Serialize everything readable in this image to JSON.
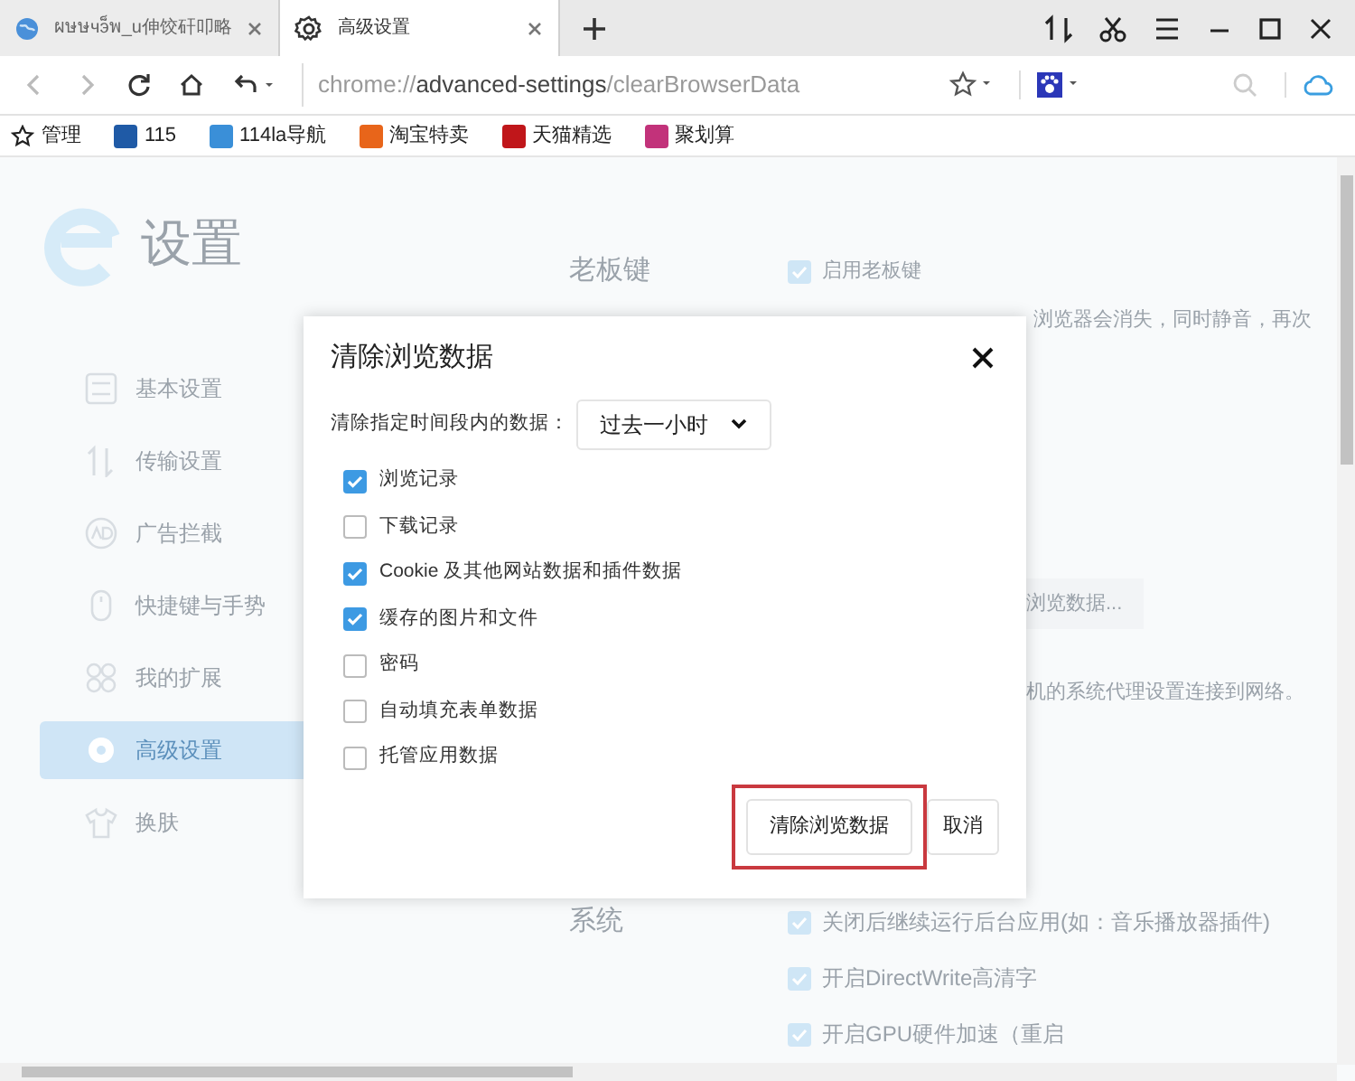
{
  "tabs": [
    {
      "title": "ผษษчэ็พ_u伸饺矸叩略",
      "selected": false
    },
    {
      "title": "高级设置",
      "selected": true
    }
  ],
  "address_bar": {
    "url_scheme": "chrome://",
    "url_host": "advanced-settings",
    "url_path": "/clearBrowserData"
  },
  "bookmarks": [
    {
      "label": "管理"
    },
    {
      "label": "115",
      "color": "#1f5aa6"
    },
    {
      "label": "114la导航",
      "color": "#3a8fd8"
    },
    {
      "label": "淘宝特卖",
      "color": "#e8651a"
    },
    {
      "label": "天猫精选",
      "color": "#c0161a"
    },
    {
      "label": "聚划算",
      "color": "#c2327a"
    }
  ],
  "sidebar": {
    "title": "设置",
    "items": [
      {
        "label": "基本设置",
        "selected": false
      },
      {
        "label": "传输设置",
        "selected": false
      },
      {
        "label": "广告拦截",
        "selected": false
      },
      {
        "label": "快捷键与手势",
        "selected": false
      },
      {
        "label": "我的扩展",
        "selected": false
      },
      {
        "label": "高级设置",
        "selected": true
      },
      {
        "label": "换肤",
        "selected": false
      }
    ]
  },
  "background": {
    "boss_key": {
      "heading": "老板键",
      "option": "启用老板键",
      "checked": true,
      "hint": "浏览器会消失，同时静音，再次"
    },
    "clear_button": "浏览数据...",
    "proxy_text": "机的系统代理设置连接到网络。",
    "system": {
      "heading": "系统",
      "options": [
        {
          "label": "关闭后继续运行后台应用(如：音乐播放器插件)",
          "checked": true
        },
        {
          "label": "开启DirectWrite高清字",
          "checked": true
        },
        {
          "label": "开启GPU硬件加速（重启",
          "checked": true
        }
      ]
    }
  },
  "dialog": {
    "title": "清除浏览数据",
    "range_label": "清除指定时间段内的数据：",
    "range_value": "过去一小时",
    "options": [
      {
        "label": "浏览记录",
        "checked": true
      },
      {
        "label": "下载记录",
        "checked": false
      },
      {
        "label": "Cookie 及其他网站数据和插件数据",
        "checked": true
      },
      {
        "label": "缓存的图片和文件",
        "checked": true
      },
      {
        "label": "密码",
        "checked": false
      },
      {
        "label": "自动填充表单数据",
        "checked": false
      },
      {
        "label": "托管应用数据",
        "checked": false
      }
    ],
    "buttons": [
      {
        "label": "清除浏览数据",
        "kind": "primary",
        "highlighted": true
      },
      {
        "label": "取消",
        "kind": "cancel",
        "highlighted": false
      }
    ]
  }
}
